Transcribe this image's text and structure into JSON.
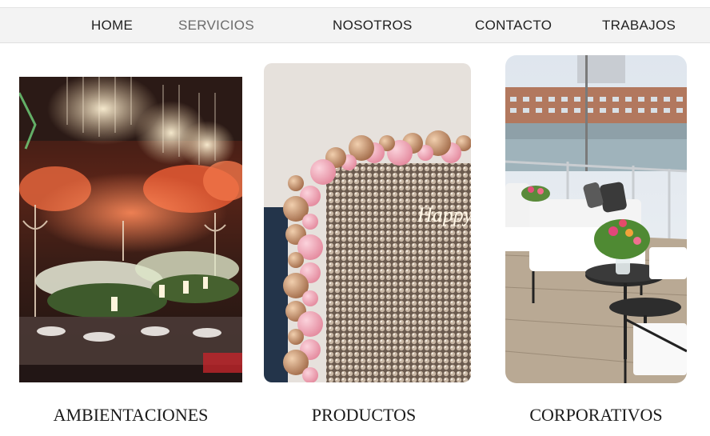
{
  "nav": {
    "items": [
      {
        "label": "HOME"
      },
      {
        "label": "SERVICIOS"
      },
      {
        "label": "NOSOTROS"
      },
      {
        "label": "CONTACTO"
      },
      {
        "label": "TRABAJOS"
      }
    ],
    "active_item": "SERVICIOS"
  },
  "services": [
    {
      "caption": "AMBIENTACIONES",
      "photo": "event-hall-chandeliers-photo"
    },
    {
      "caption": "PRODUCTOS",
      "photo": "balloon-arch-sequin-wall-photo"
    },
    {
      "caption": "CORPORATIVOS",
      "photo": "terrace-lounge-furniture-photo"
    }
  ],
  "product_photo_sign_text": "Happy B",
  "colors": {
    "nav_background": "#f3f3f3",
    "nav_text": "#222222",
    "nav_active_text": "#6b6b6b",
    "caption_text": "#1a1a1a"
  }
}
